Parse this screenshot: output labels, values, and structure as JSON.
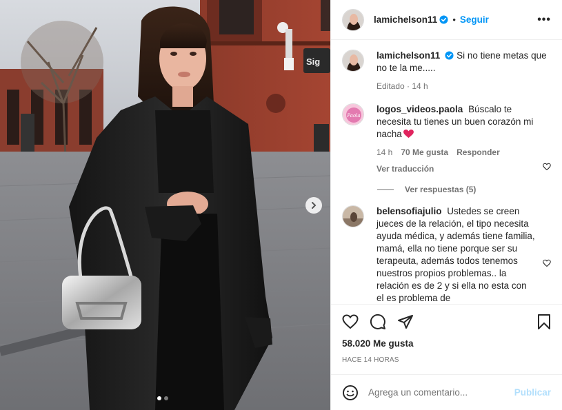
{
  "post": {
    "username": "lamichelson11",
    "follow_label": "Seguir",
    "separator": "•",
    "more_label": "•••",
    "caption": "Si no tiene metas que no te la me.....",
    "caption_meta": "Editado · 14 h"
  },
  "comments": [
    {
      "username": "logos_videos.paola",
      "text": "Búscalo te necesita tu tienes un buen corazón mi nacha",
      "time": "14 h",
      "likes": "70 Me gusta",
      "reply": "Responder",
      "translate": "Ver traducción",
      "avatar_text": "Paola"
    },
    {
      "username": "belensofiajulio",
      "text": "Ustedes se creen jueces de la relación, el tipo necesita ayuda médica, y además tiene familia, mamá, ella no tiene porque ser su terapeuta, además todos tenemos nuestros propios problemas.. la relación es de 2 y si ella no esta con el es problema de"
    }
  ],
  "view_replies": "Ver respuestas (5)",
  "likes_count": "58.020 Me gusta",
  "post_time": "HACE 14 HORAS",
  "comment_box": {
    "placeholder": "Agrega un comentario...",
    "publish_label": "Publicar"
  },
  "photo": {
    "storefront_sign": "Sig"
  },
  "colors": {
    "accent": "#0095f6",
    "publish_disabled": "#b2dffc",
    "verified": "#0095f6",
    "heart": "#ed4956"
  }
}
